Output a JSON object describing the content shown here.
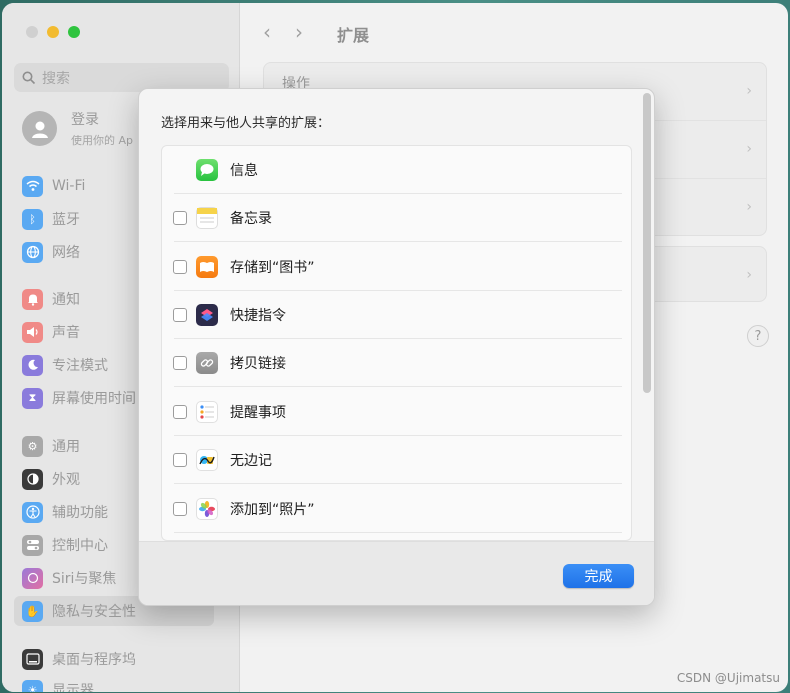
{
  "sidebar": {
    "search_placeholder": "搜索",
    "profile": {
      "title": "登录",
      "subtitle": "使用你的 Ap"
    },
    "items": [
      {
        "label": "Wi-Fi",
        "icon": "wifi-icon",
        "color": "#5aa9f2"
      },
      {
        "label": "蓝牙",
        "icon": "bluetooth-icon",
        "color": "#5aa9f2"
      },
      {
        "label": "网络",
        "icon": "globe-icon",
        "color": "#5aa9f2"
      },
      {
        "label": "通知",
        "icon": "bell-icon",
        "color": "#f08a87"
      },
      {
        "label": "声音",
        "icon": "speaker-icon",
        "color": "#f08a87"
      },
      {
        "label": "专注模式",
        "icon": "moon-icon",
        "color": "#8a7bdc"
      },
      {
        "label": "屏幕使用时间",
        "icon": "hourglass-icon",
        "color": "#8a7bdc"
      },
      {
        "label": "通用",
        "icon": "gear-icon",
        "color": "#a8a8a8"
      },
      {
        "label": "外观",
        "icon": "appearance-icon",
        "color": "#3a3a3a"
      },
      {
        "label": "辅助功能",
        "icon": "accessibility-icon",
        "color": "#5aa9f2"
      },
      {
        "label": "控制中心",
        "icon": "control-center-icon",
        "color": "#a8a8a8"
      },
      {
        "label": "Siri与聚焦",
        "icon": "siri-icon",
        "color": "#9a7ad8"
      },
      {
        "label": "隐私与安全性",
        "icon": "hand-icon",
        "color": "#5aa9f2"
      },
      {
        "label": "桌面与程序坞",
        "icon": "dock-icon",
        "color": "#3a3a3a"
      },
      {
        "label": "显示器",
        "icon": "display-icon",
        "color": "#5aa9f2"
      }
    ]
  },
  "main": {
    "title": "扩展",
    "cards": [
      {
        "label": "操作"
      }
    ]
  },
  "dialog": {
    "title": "选择用来与他人共享的扩展：",
    "items": [
      {
        "label": "信息",
        "icon": "messages-icon",
        "checkbox": false
      },
      {
        "label": "备忘录",
        "icon": "notes-icon",
        "checkbox": true
      },
      {
        "label": "存储到“图书”",
        "icon": "books-icon",
        "checkbox": true
      },
      {
        "label": "快捷指令",
        "icon": "shortcuts-icon",
        "checkbox": true
      },
      {
        "label": "拷贝链接",
        "icon": "link-icon",
        "checkbox": true
      },
      {
        "label": "提醒事项",
        "icon": "reminders-icon",
        "checkbox": true
      },
      {
        "label": "无边记",
        "icon": "freeform-icon",
        "checkbox": true
      },
      {
        "label": "添加到“照片”",
        "icon": "photos-icon",
        "checkbox": true
      }
    ],
    "done_label": "完成"
  },
  "watermark": "CSDN @Ujimatsu"
}
